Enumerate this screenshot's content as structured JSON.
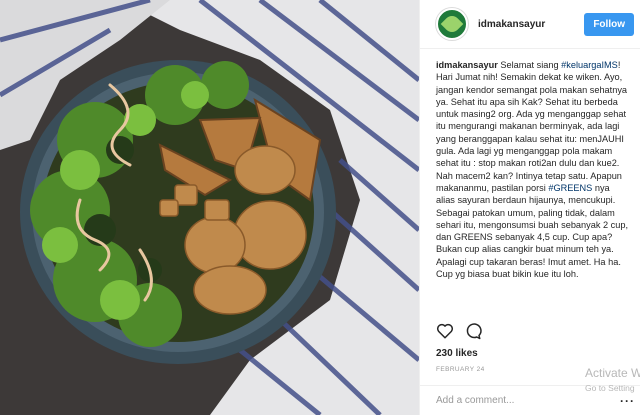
{
  "post": {
    "image_alt": "Salad bowl with greens, potato wedges and crispy tempeh on a striped cloth"
  },
  "header": {
    "username": "idmakansayur",
    "follow_label": "Follow",
    "avatar_icon": "idmakansayur-logo-icon"
  },
  "caption": {
    "username": "idmakansayur",
    "text_before_tag1": " Selamat siang ",
    "tag1": "#keluargaIMS",
    "text_mid": "! Hari Jumat nih! Semakin dekat ke wiken. Ayo, jangan kendor semangat pola makan sehatnya ya. Sehat itu apa sih Kak? Sehat itu berbeda untuk masing2 org. Ada yg menganggap sehat itu mengurangi makanan berminyak, ada lagi yang beranggapan kalau sehat itu: menJAUHI gula. Ada lagi yg menganggap pola makam sehat itu : stop makan roti2an dulu dan kue2. Nah macem2 kan? Intinya tetap satu. Apapun makananmu, pastilan porsi ",
    "tag2": "#GREENS",
    "text_after_tag2": " nya alias sayuran berdaun hijaunya, mencukupi. Sebagai patokan umum, paling tidak, dalam sehari itu, mengonsumsi buah sebanyak 2 cup, dan GREENS sebanyak 4,5 cup. Cup apa? Bukan cup alias cangkir buat minum teh ya. Apalagi cup takaran beras! Imut amet. Ha ha. Cup yg biasa buat bikin kue itu loh."
  },
  "actions": {
    "like_icon": "heart-icon",
    "comment_icon": "comment-bubble-icon"
  },
  "likes": "230 likes",
  "date": "FEBRUARY 24",
  "comment": {
    "placeholder": "Add a comment...",
    "more_icon": "more-options-icon"
  },
  "watermark": {
    "line1": "Activate W",
    "line2": "Go to Setting"
  }
}
